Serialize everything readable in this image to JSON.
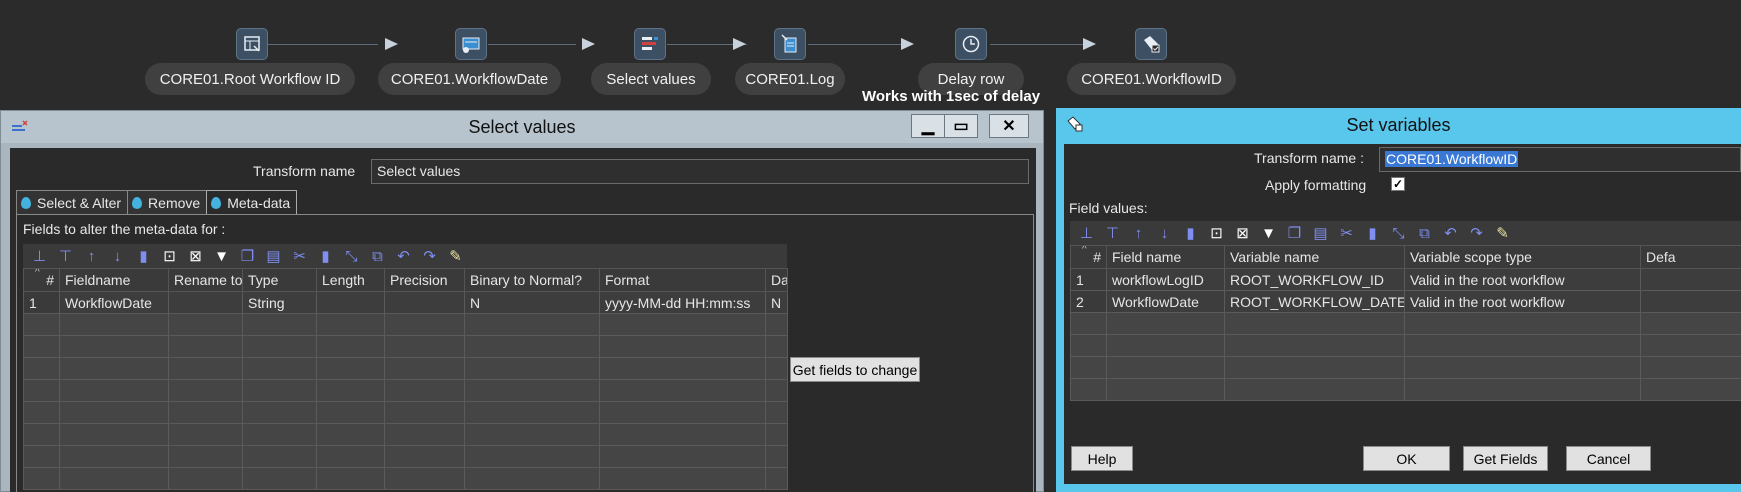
{
  "flow": {
    "nodes": [
      {
        "label": "CORE01.Root Workflow ID",
        "icon": "table-input-icon"
      },
      {
        "label": "CORE01.WorkflowDate",
        "icon": "date-input-icon"
      },
      {
        "label": "Select values",
        "icon": "select-values-icon"
      },
      {
        "label": "CORE01.Log",
        "icon": "log-icon"
      },
      {
        "label": "Delay row",
        "icon": "clock-icon"
      },
      {
        "label": "CORE01.WorkflowID",
        "icon": "set-variables-icon"
      }
    ],
    "note": "Works with 1sec of delay"
  },
  "select_values": {
    "title": "Select values",
    "window_buttons": {
      "minimize": "▁",
      "maximize": "▭",
      "close": "✕"
    },
    "transform_name_label": "Transform name",
    "transform_name_value": "Select values",
    "tabs": [
      {
        "label": "Select & Alter",
        "active": false
      },
      {
        "label": "Remove",
        "active": false
      },
      {
        "label": "Meta-data",
        "active": true
      }
    ],
    "fields_label": "Fields to alter the meta-data for :",
    "columns": [
      "#",
      "Fieldname",
      "Rename to",
      "Type",
      "Length",
      "Precision",
      "Binary to Normal?",
      "Format",
      "Da"
    ],
    "rows": [
      [
        "1",
        "WorkflowDate",
        "",
        "String",
        "",
        "",
        "N",
        "yyyy-MM-dd HH:mm:ss",
        "N"
      ]
    ],
    "get_fields_button": "Get fields to change"
  },
  "set_variables": {
    "title": "Set variables",
    "transform_name_label": "Transform name :",
    "transform_name_value": "CORE01.WorkflowID",
    "apply_formatting_label": "Apply formatting",
    "apply_formatting_checked": true,
    "field_values_label": "Field values:",
    "columns": [
      "#",
      "Field name",
      "Variable name",
      "Variable scope type",
      "Defa"
    ],
    "rows": [
      [
        "1",
        "workflowLogID",
        "ROOT_WORKFLOW_ID",
        "Valid in the root workflow",
        ""
      ],
      [
        "2",
        "WorkflowDate",
        "ROOT_WORKFLOW_DATE",
        "Valid in the root workflow",
        ""
      ]
    ],
    "buttons": {
      "help": "Help",
      "ok": "OK",
      "get_fields": "Get Fields",
      "cancel": "Cancel"
    }
  },
  "colors": {
    "canvas": "#2b2b2b",
    "set_variables_titlebar": "#59c7eb",
    "select_values_titlebar": "#b7c4cd",
    "toolbar_icon": "#7f8ef0"
  }
}
